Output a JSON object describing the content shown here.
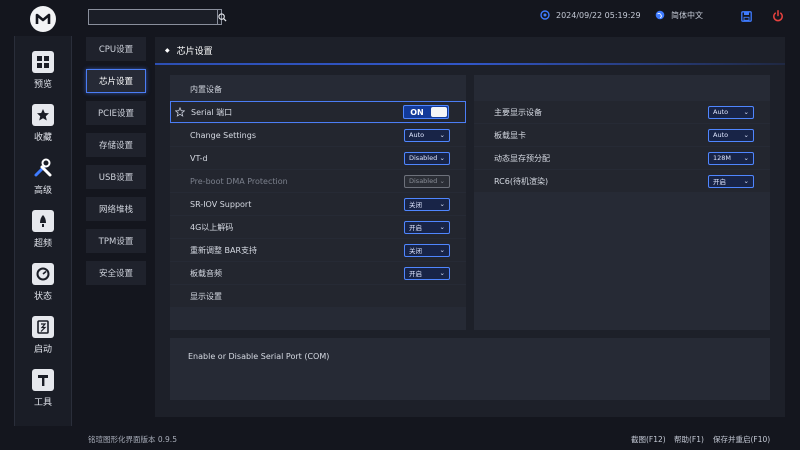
{
  "header": {
    "search": {
      "placeholder": "",
      "value": ""
    },
    "datetime": "2024/09/22 05:19:29",
    "language": "简体中文"
  },
  "sidebar": {
    "items": [
      {
        "label": "预览",
        "icon": "grid-icon"
      },
      {
        "label": "收藏",
        "icon": "star-icon"
      },
      {
        "label": "高级",
        "icon": "wrench-icon",
        "active": true
      },
      {
        "label": "超频",
        "icon": "rocket-icon"
      },
      {
        "label": "状态",
        "icon": "gauge-icon"
      },
      {
        "label": "启动",
        "icon": "boot-icon"
      },
      {
        "label": "工具",
        "icon": "hammer-icon"
      }
    ]
  },
  "subnav": {
    "items": [
      {
        "label": "CPU设置"
      },
      {
        "label": "芯片设置",
        "active": true
      },
      {
        "label": "PCIE设置"
      },
      {
        "label": "存储设置"
      },
      {
        "label": "USB设置"
      },
      {
        "label": "网络堆栈"
      },
      {
        "label": "TPM设置"
      },
      {
        "label": "安全设置"
      }
    ]
  },
  "panel": {
    "title": "芯片设置",
    "left": {
      "section_onboard": "内置设备",
      "section_display": "显示设置",
      "rows": [
        {
          "label": "Serial 端口",
          "type": "toggle",
          "value": "ON"
        },
        {
          "label": "Change Settings",
          "type": "dropdown",
          "value": "Auto"
        },
        {
          "label": "VT-d",
          "type": "dropdown",
          "value": "Disabled"
        },
        {
          "label": "Pre-boot DMA Protection",
          "type": "dropdown",
          "value": "Disabled",
          "disabled": true
        },
        {
          "label": "SR-IOV Support",
          "type": "dropdown",
          "value": "关闭"
        },
        {
          "label": "4G以上解码",
          "type": "dropdown",
          "value": "开启"
        },
        {
          "label": "重新调整 BAR支持",
          "type": "dropdown",
          "value": "关闭"
        },
        {
          "label": "板载音频",
          "type": "dropdown",
          "value": "开启"
        }
      ]
    },
    "right": {
      "rows": [
        {
          "label": "主要显示设备",
          "type": "dropdown",
          "value": "Auto"
        },
        {
          "label": "板载显卡",
          "type": "dropdown",
          "value": "Auto"
        },
        {
          "label": "动态显存预分配",
          "type": "dropdown",
          "value": "128M"
        },
        {
          "label": "RC6(待机渲染)",
          "type": "dropdown",
          "value": "开启"
        }
      ]
    },
    "description": "Enable or Disable Serial Port (COM)"
  },
  "footer": {
    "version": "铭瑄图形化界面版本 0.9.5",
    "screenshot": "截图(F12)",
    "help": "帮助(F1)",
    "save_restart": "保存并重启(F10)"
  },
  "colors": {
    "accent": "#4f86ff",
    "background": "#14161e",
    "panel": "#1d2029",
    "power": "#e8423f"
  }
}
